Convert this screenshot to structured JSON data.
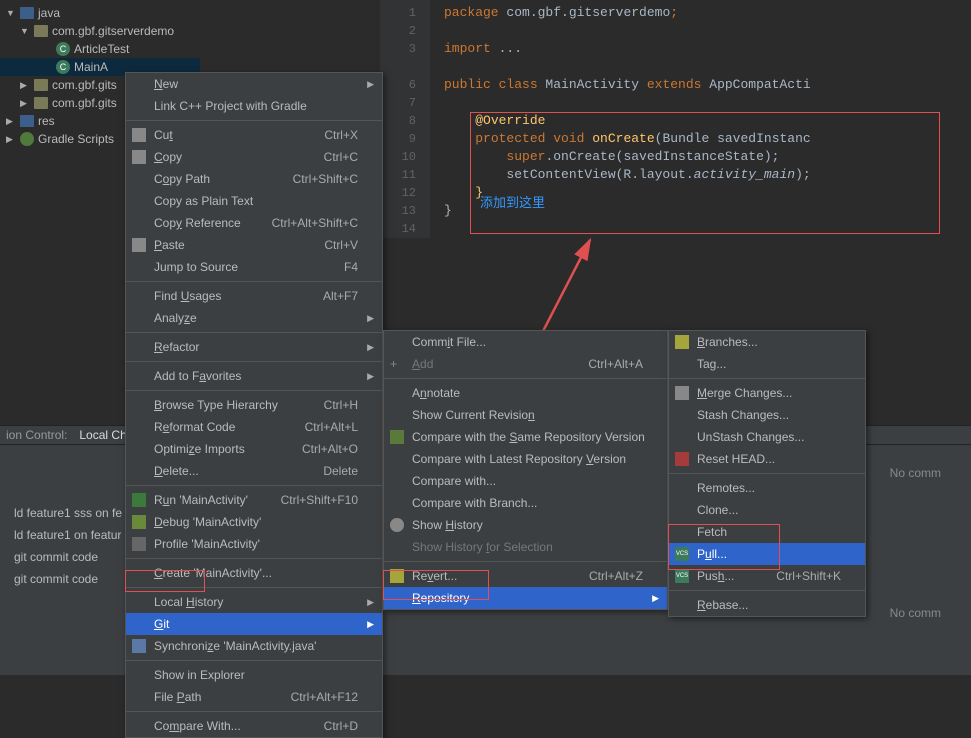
{
  "tree": {
    "root": "java",
    "pkg": "com.gbf.gitserverdemo",
    "articleTest": "ArticleTest",
    "mainActivity": "MainA",
    "cut1": "com.gbf.gits",
    "cut2": "com.gbf.gits",
    "res": "res",
    "gradle": "Gradle Scripts"
  },
  "code": {
    "l1": "package com.gbf.gitserverdemo;",
    "l3": "import ...",
    "l6a": "public class ",
    "l6b": "MainActivity ",
    "l6c": "extends ",
    "l6d": "AppCompatActi",
    "l8": "@Override",
    "l9a": "protected void ",
    "l9b": "onCreate",
    "l9c": "(Bundle savedInstanc",
    "l10a": "super",
    "l10b": ".onCreate(savedInstanceState);",
    "l11a": "setContentView(R.layout.",
    "l11b": "activity_main",
    "l11c": ");"
  },
  "anno": {
    "blue": "添加到这里",
    "red": "添加"
  },
  "menu1": {
    "new": "New",
    "linkcpp": "Link C++ Project with Gradle",
    "cut": "Cut",
    "cut_s": "Ctrl+X",
    "copy": "Copy",
    "copy_s": "Ctrl+C",
    "copy_path": "Copy Path",
    "copy_path_s": "Ctrl+Shift+C",
    "copy_plain": "Copy as Plain Text",
    "copy_ref": "Copy Reference",
    "copy_ref_s": "Ctrl+Alt+Shift+C",
    "paste": "Paste",
    "paste_s": "Ctrl+V",
    "jump": "Jump to Source",
    "jump_s": "F4",
    "find_usages": "Find Usages",
    "find_usages_s": "Alt+F7",
    "analyze": "Analyze",
    "refactor": "Refactor",
    "favorites": "Add to Favorites",
    "browse": "Browse Type Hierarchy",
    "browse_s": "Ctrl+H",
    "reformat": "Reformat Code",
    "reformat_s": "Ctrl+Alt+L",
    "optimize": "Optimize Imports",
    "optimize_s": "Ctrl+Alt+O",
    "delete": "Delete...",
    "delete_s": "Delete",
    "run": "Run 'MainActivity'",
    "run_s": "Ctrl+Shift+F10",
    "debug": "Debug 'MainActivity'",
    "profile": "Profile 'MainActivity'",
    "create": "Create 'MainActivity'...",
    "local_hist": "Local History",
    "git": "Git",
    "sync": "Synchronize 'MainActivity.java'",
    "show_expl": "Show in Explorer",
    "file_path": "File Path",
    "file_path_s": "Ctrl+Alt+F12",
    "compare": "Compare With...",
    "compare_s": "Ctrl+D"
  },
  "menu2": {
    "commit": "Commit File...",
    "add": "Add",
    "add_s": "Ctrl+Alt+A",
    "annotate": "Annotate",
    "show_rev": "Show Current Revision",
    "cmp_same": "Compare with the Same Repository Version",
    "cmp_latest": "Compare with Latest Repository Version",
    "cmp_with": "Compare with...",
    "cmp_branch": "Compare with Branch...",
    "show_hist": "Show History",
    "show_hist_sel": "Show History for Selection",
    "revert": "Revert...",
    "revert_s": "Ctrl+Alt+Z",
    "repository": "Repository"
  },
  "menu3": {
    "branches": "Branches...",
    "tag": "Tag...",
    "merge": "Merge Changes...",
    "stash": "Stash Changes...",
    "unstash": "UnStash Changes...",
    "reset": "Reset HEAD...",
    "remotes": "Remotes...",
    "clone": "Clone...",
    "fetch": "Fetch",
    "pull": "Pull...",
    "push": "Push...",
    "push_s": "Ctrl+Shift+K",
    "rebase": "Rebase..."
  },
  "bottom": {
    "tab1": "ion Control:",
    "tab2": "Local Ch",
    "row1": "ld feature1 sss on fe",
    "row2": "ld feature1 on  featur",
    "row3": "git commit code",
    "row4": "git commit code",
    "nocommit": "No comm"
  }
}
